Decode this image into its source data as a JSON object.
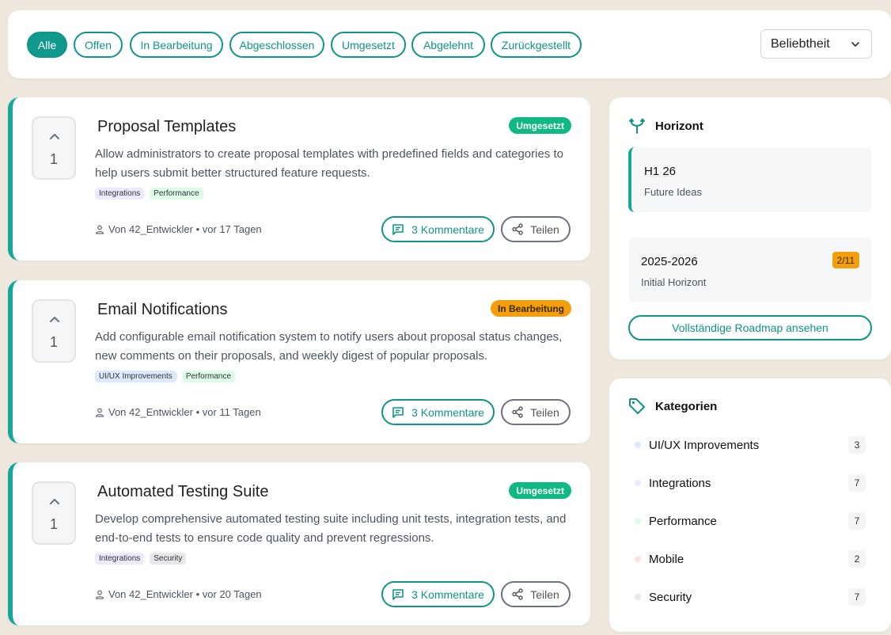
{
  "filters": {
    "pills": [
      "Alle",
      "Offen",
      "In Bearbeitung",
      "Abgeschlossen",
      "Umgesetzt",
      "Abgelehnt",
      "Zurückgestellt"
    ],
    "active": "Alle",
    "sort_value": "Beliebtheit"
  },
  "proposals": [
    {
      "title": "Proposal Templates",
      "votes": "1",
      "status": "Umgesetzt",
      "description": "Allow administrators to create proposal templates with predefined fields and categories to help users submit better structured feature requests.",
      "tags": [
        "Integrations",
        "Performance"
      ],
      "meta": "Von 42_Entwickler • vor 17 Tagen",
      "comments_label": "3 Kommentare",
      "share_label": "Teilen"
    },
    {
      "title": "Email Notifications",
      "votes": "1",
      "status": "In Bearbeitung",
      "description": "Add configurable email notification system to notify users about proposal status changes, new comments on their proposals, and weekly digest of popular proposals.",
      "tags": [
        "UI/UX Improvements",
        "Performance"
      ],
      "meta": "Von 42_Entwickler • vor 11 Tagen",
      "comments_label": "3 Kommentare",
      "share_label": "Teilen"
    },
    {
      "title": "Automated Testing Suite",
      "votes": "1",
      "status": "Umgesetzt",
      "description": "Develop comprehensive automated testing suite including unit tests, integration tests, and end-to-end tests to ensure code quality and prevent regressions.",
      "tags": [
        "Integrations",
        "Security"
      ],
      "meta": "Von 42_Entwickler • vor 20 Tagen",
      "comments_label": "3 Kommentare",
      "share_label": "Teilen"
    }
  ],
  "horizon": {
    "heading": "Horizont",
    "items": [
      {
        "title": "H1 26",
        "subtitle": "Future Ideas"
      },
      {
        "title": "2025-2026",
        "subtitle": "Initial Horizont",
        "badge": "2/11"
      }
    ],
    "roadmap_label": "Vollständige Roadmap ansehen"
  },
  "categories": {
    "heading": "Kategorien",
    "items": [
      {
        "label": "UI/UX Improvements",
        "count": "3"
      },
      {
        "label": "Integrations",
        "count": "7"
      },
      {
        "label": "Performance",
        "count": "7"
      },
      {
        "label": "Mobile",
        "count": "2"
      },
      {
        "label": "Security",
        "count": "7"
      }
    ]
  },
  "colors": {
    "accent": "#0f9488",
    "status_umgesetzt": "#10b981",
    "status_in_bearbeitung": "#f59e0b",
    "tag_integrations": "#ede9fe",
    "tag_performance": "#dcfce7",
    "tag_uiux": "#dbeafe",
    "tag_security": "#e5e7eb",
    "background": "#efe8de"
  }
}
